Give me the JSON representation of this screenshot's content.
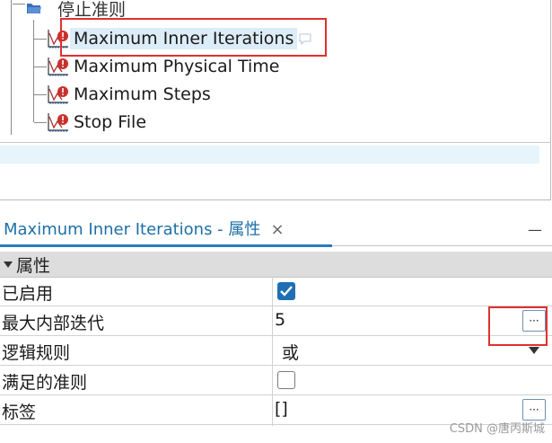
{
  "tree": {
    "root_label": "停止准则",
    "items": [
      {
        "label": "Maximum Inner Iterations",
        "selected": true
      },
      {
        "label": "Maximum Physical Time",
        "selected": false
      },
      {
        "label": "Maximum Steps",
        "selected": false
      },
      {
        "label": "Stop File",
        "selected": false
      }
    ]
  },
  "properties": {
    "tab_title": "Maximum Inner Iterations - 属性",
    "close_glyph": "×",
    "minimize_glyph": "—",
    "section_title": "属性",
    "rows": [
      {
        "name": "已启用",
        "checked": true
      },
      {
        "name": "最大内部迭代",
        "value": "5",
        "button": "···"
      },
      {
        "name": "逻辑规则",
        "value": "或"
      },
      {
        "name": "满足的准则",
        "checked": false
      },
      {
        "name": "标签",
        "value": "[]",
        "button": "···"
      }
    ]
  },
  "watermark": "CSDN @唐丙斯城",
  "colors": {
    "selection_bg": "#dcecf8",
    "highlight_red": "#e03030",
    "tab_blue": "#1e6fa8",
    "checkbox_blue": "#1f6fb2"
  }
}
